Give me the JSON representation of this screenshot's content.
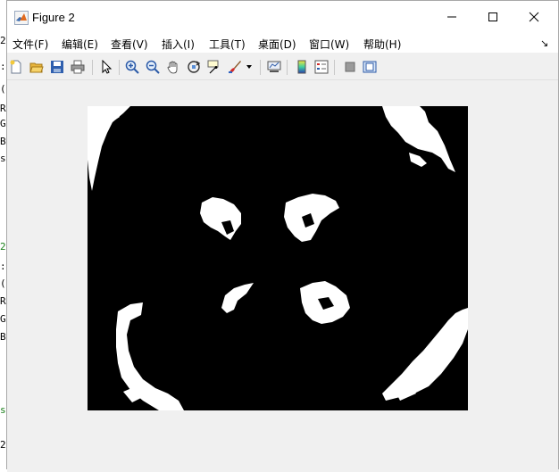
{
  "window": {
    "title": "Figure 2"
  },
  "menu": [
    {
      "label": "文件(F)"
    },
    {
      "label": "编辑(E)"
    },
    {
      "label": "查看(V)"
    },
    {
      "label": "插入(I)"
    },
    {
      "label": "工具(T)"
    },
    {
      "label": "桌面(D)"
    },
    {
      "label": "窗口(W)"
    },
    {
      "label": "帮助(H)"
    }
  ],
  "menu_overflow_glyph": "↘",
  "toolbar": {
    "icons": [
      "new-figure-icon",
      "open-file-icon",
      "save-icon",
      "print-icon",
      "select-arrow-icon",
      "zoom-in-icon",
      "zoom-out-icon",
      "pan-hand-icon",
      "rotate-3d-icon",
      "data-cursor-icon",
      "brush-icon",
      "brush-dropdown-icon",
      "link-plot-icon",
      "colorbar-icon",
      "legend-icon",
      "hide-plot-tools-icon",
      "show-plot-tools-icon"
    ]
  },
  "background_fragments": {
    "left": [
      "2",
      ":",
      "(",
      "R",
      "G",
      "B",
      "s",
      "2",
      ":",
      "(",
      "R",
      "G",
      "B",
      "s",
      "2"
    ],
    "right": [
      ",",
      ","
    ]
  },
  "image": {
    "description": "",
    "foreground": "#ffffff",
    "background": "#000000"
  }
}
